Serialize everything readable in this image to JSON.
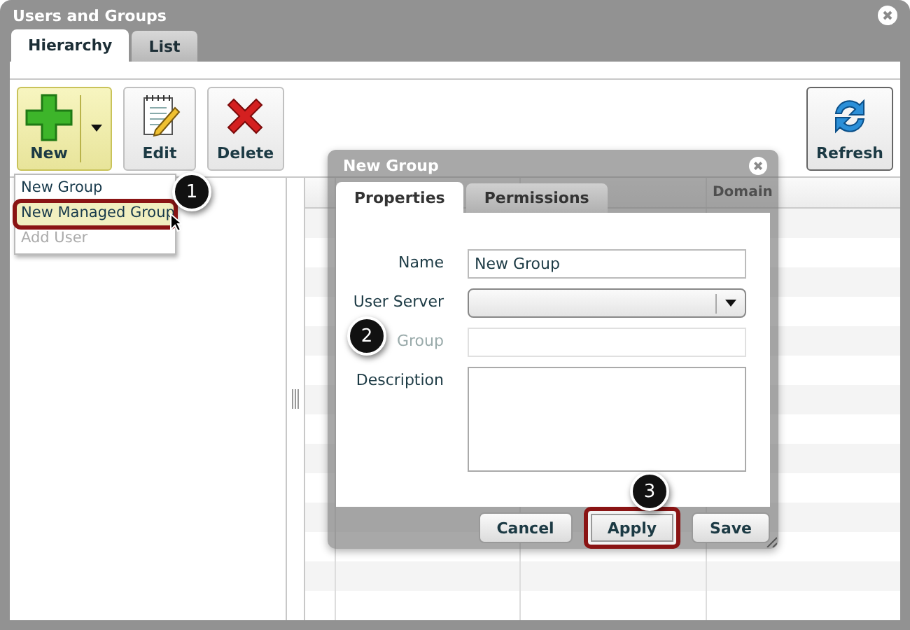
{
  "window": {
    "title": "Users and Groups"
  },
  "tabs": [
    {
      "label": "Hierarchy",
      "selected": true
    },
    {
      "label": "List",
      "selected": false
    }
  ],
  "toolbar": [
    {
      "label": "New",
      "kind": "new"
    },
    {
      "label": "Edit",
      "kind": "edit"
    },
    {
      "label": "Delete",
      "kind": "delete"
    },
    {
      "label": "Refresh",
      "kind": "refresh"
    }
  ],
  "new_menu": [
    {
      "label": "New Group",
      "disabled": false,
      "highlighted": false
    },
    {
      "label": "New Managed Group",
      "disabled": false,
      "highlighted": true
    },
    {
      "label": "Add User",
      "disabled": true,
      "highlighted": false
    }
  ],
  "grid": {
    "columns": [
      {
        "label": "Domain"
      }
    ]
  },
  "dialog": {
    "title": "New Group",
    "tabs": [
      {
        "label": "Properties",
        "selected": true
      },
      {
        "label": "Permissions",
        "selected": false
      }
    ],
    "fields": [
      {
        "label": "Name",
        "kind": "text",
        "value": "New Group",
        "disabled": false
      },
      {
        "label": "User Server",
        "kind": "select",
        "disabled": false
      },
      {
        "label": "Group",
        "kind": "text",
        "disabled": true
      },
      {
        "label": "Description",
        "kind": "textarea",
        "disabled": false
      }
    ],
    "buttons": [
      {
        "label": "Cancel",
        "highlighted": false
      },
      {
        "label": "Apply",
        "highlighted": true
      },
      {
        "label": "Save",
        "highlighted": false
      }
    ]
  },
  "callouts": [
    {
      "number": "1"
    },
    {
      "number": "2"
    },
    {
      "number": "3"
    }
  ]
}
